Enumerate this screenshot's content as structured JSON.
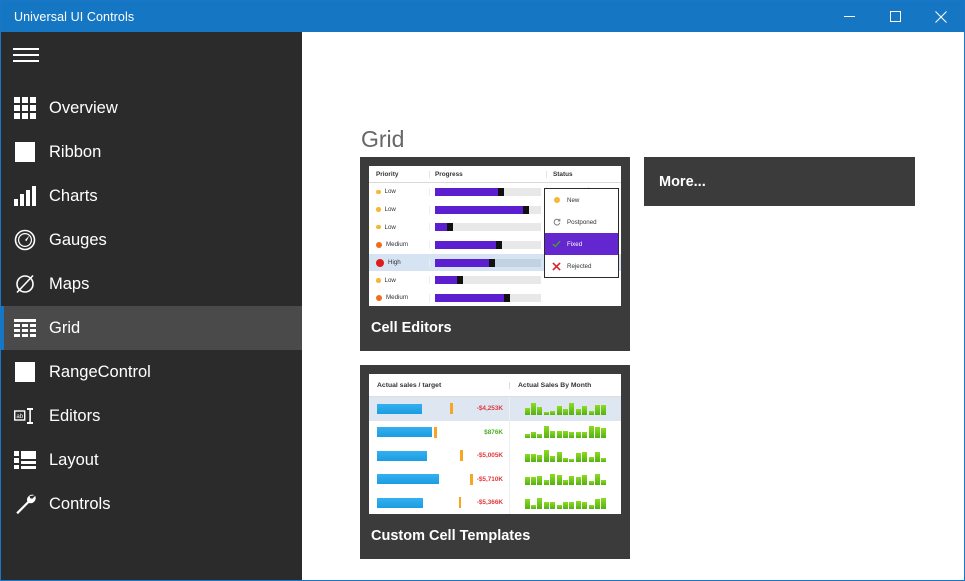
{
  "window": {
    "title": "Universal UI Controls",
    "controls": [
      {
        "name": "minimize",
        "glyph": "minimize-icon"
      },
      {
        "name": "maximize",
        "glyph": "maximize-icon"
      },
      {
        "name": "close",
        "glyph": "close-icon"
      }
    ],
    "border_color": "#1a76c6",
    "titlebar_color": "#1577c4"
  },
  "sidebar": {
    "background": "#2b2b2b",
    "selected_background": "#4a4a4a",
    "accent": "#1577c4",
    "hamburger": "hamburger-icon",
    "items": [
      {
        "label": "Overview",
        "icon": "grid-tiles-icon",
        "selected": false
      },
      {
        "label": "Ribbon",
        "icon": "square-icon",
        "selected": false
      },
      {
        "label": "Charts",
        "icon": "bar-chart-icon",
        "selected": false
      },
      {
        "label": "Gauges",
        "icon": "gauge-icon",
        "selected": false
      },
      {
        "label": "Maps",
        "icon": "compass-icon",
        "selected": false
      },
      {
        "label": "Grid",
        "icon": "table-icon",
        "selected": true
      },
      {
        "label": "RangeControl",
        "icon": "square-icon",
        "selected": false
      },
      {
        "label": "Editors",
        "icon": "textbox-icon",
        "selected": false
      },
      {
        "label": "Layout",
        "icon": "layout-icon",
        "selected": false
      },
      {
        "label": "Controls",
        "icon": "wrench-icon",
        "selected": false
      }
    ]
  },
  "main": {
    "page_title": "Grid",
    "more_tile": {
      "label": "More..."
    },
    "cards": [
      {
        "title": "Cell Editors",
        "preview": {
          "columns": [
            "Priority",
            "Progress",
            "Status"
          ],
          "rows": [
            {
              "priority": "Low",
              "priority_level": "low",
              "progress": 62,
              "highlight": false
            },
            {
              "priority": "Low",
              "priority_level": "low",
              "progress": 86,
              "highlight": false
            },
            {
              "priority": "Low",
              "priority_level": "low",
              "progress": 14,
              "highlight": false
            },
            {
              "priority": "Medium",
              "priority_level": "medium",
              "progress": 60,
              "highlight": false
            },
            {
              "priority": "High",
              "priority_level": "high",
              "progress": 54,
              "highlight": true
            },
            {
              "priority": "Low",
              "priority_level": "low",
              "progress": 24,
              "highlight": false
            },
            {
              "priority": "Medium",
              "priority_level": "medium",
              "progress": 68,
              "highlight": false
            }
          ],
          "status_check": "check-icon",
          "dropdown": {
            "options": [
              {
                "label": "New",
                "icon": "orange-dot-icon",
                "selected": false
              },
              {
                "label": "Postponed",
                "icon": "refresh-icon",
                "selected": false
              },
              {
                "label": "Fixed",
                "icon": "green-check-icon",
                "selected": true
              },
              {
                "label": "Rejected",
                "icon": "red-cross-icon",
                "selected": false
              }
            ]
          },
          "colors": {
            "progress_fill": "#5b1fd0",
            "progress_track": "#e8e8e8",
            "row_highlight": "#d5e3f2",
            "dropdown_selected": "#6427cf",
            "priority_low": "#f7b733",
            "priority_medium": "#f26a1b",
            "priority_high": "#e01b1b"
          }
        }
      },
      {
        "title": "Custom Cell Templates",
        "preview": {
          "columns": [
            "Actual sales / target",
            "Actual Sales By Month"
          ],
          "rows": [
            {
              "bar": 72,
              "target": 118,
              "amount": "-$4,253K",
              "sign": "neg",
              "highlight": true,
              "spark": [
                40,
                75,
                45,
                18,
                22,
                55,
                35,
                70,
                32,
                52,
                22,
                62,
                60
              ]
            },
            {
              "bar": 88,
              "target": 92,
              "amount": "$876K",
              "sign": "pos",
              "highlight": false,
              "spark": [
                22,
                35,
                28,
                72,
                45,
                42,
                42,
                40,
                40,
                40,
                78,
                68,
                60
              ]
            },
            {
              "bar": 80,
              "target": 134,
              "amount": "-$5,005K",
              "sign": "neg",
              "highlight": false,
              "spark": [
                46,
                44,
                38,
                70,
                32,
                62,
                20,
                18,
                52,
                58,
                28,
                60,
                25
              ]
            },
            {
              "bar": 100,
              "target": 150,
              "amount": "-$5,710K",
              "sign": "neg",
              "highlight": false,
              "spark": [
                48,
                52,
                56,
                30,
                66,
                62,
                30,
                58,
                52,
                62,
                28,
                66,
                30
              ]
            },
            {
              "bar": 74,
              "target": 132,
              "amount": "-$5,366K",
              "sign": "neg",
              "highlight": false,
              "spark": [
                62,
                22,
                64,
                38,
                40,
                20,
                42,
                40,
                44,
                42,
                20,
                58,
                64
              ]
            }
          ],
          "colors": {
            "bar": "#1a9de2",
            "target_marker": "#f5a623",
            "spark": "#6fc41a",
            "negative": "#e0393e",
            "positive": "#4caf22",
            "row_highlight": "#dde6f1"
          }
        }
      }
    ],
    "card_background": "#3b3b3b"
  }
}
